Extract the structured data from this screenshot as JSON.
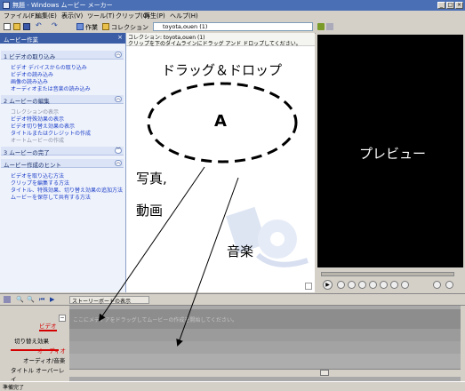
{
  "window": {
    "title": "無題 - Windows ムービー メーカー",
    "minimize": "_",
    "maximize": "□",
    "close": "×"
  },
  "menu": [
    "ファイル(F)",
    "編集(E)",
    "表示(V)",
    "ツール(T)",
    "クリップ(C)",
    "再生(P)",
    "ヘルプ(H)"
  ],
  "toolbar": {
    "tasks": "作業",
    "collections": "コレクション",
    "collection_select": "toyota,ouen (1)"
  },
  "tasks_pane": {
    "title": "ムービー作業",
    "sections": [
      {
        "label": "1  ビデオの取り込み",
        "links": [
          "ビデオ デバイスからの取り込み",
          "ビデオの読み込み",
          "画像の読み込み",
          "オーディオまたは音楽の読み込み"
        ]
      },
      {
        "label": "2  ムービーの編集",
        "links": [
          "コレクションの表示",
          "ビデオ特殊効果の表示",
          "ビデオ切り替え効果の表示",
          "タイトルまたはクレジットの作成",
          "オートムービーの作成"
        ]
      },
      {
        "label": "3  ムービーの完了",
        "links": []
      },
      {
        "label": "ムービー作成のヒント",
        "links": [
          "ビデオを取り込む方法",
          "クリップを編集する方法",
          "タイトル、特殊効果、切り替え効果の追加方法",
          "ムービーを保存して共有する方法"
        ]
      }
    ]
  },
  "collection": {
    "header_line1": "コレクション: toyota,ouen (1)",
    "header_line2": "クリップを下のタイムラインにドラッグ アンド ドロップしてください。"
  },
  "annotations": {
    "drag_drop": "ドラッグ＆ドロップ",
    "ellipse_label": "A",
    "photo_video_1": "写真,",
    "photo_video_2": "動画",
    "music": "音楽",
    "preview": "プレビュー"
  },
  "timeline": {
    "storyboard_button": "ストーリーボードの表示",
    "tracks": [
      "ビデオ",
      "切り替え効果",
      "オーディオ",
      "オーディオ/音楽",
      "タイトル オーバーレイ"
    ],
    "video_track_hint": "ここにメディアをドラッグしてムービーの作成を開始してください。"
  },
  "status": "準備完了",
  "colors": {
    "title_bar": "#4a6fb5",
    "task_header": "#3a5da5",
    "link": "#1d3fc9",
    "label_red": "#d40000"
  }
}
